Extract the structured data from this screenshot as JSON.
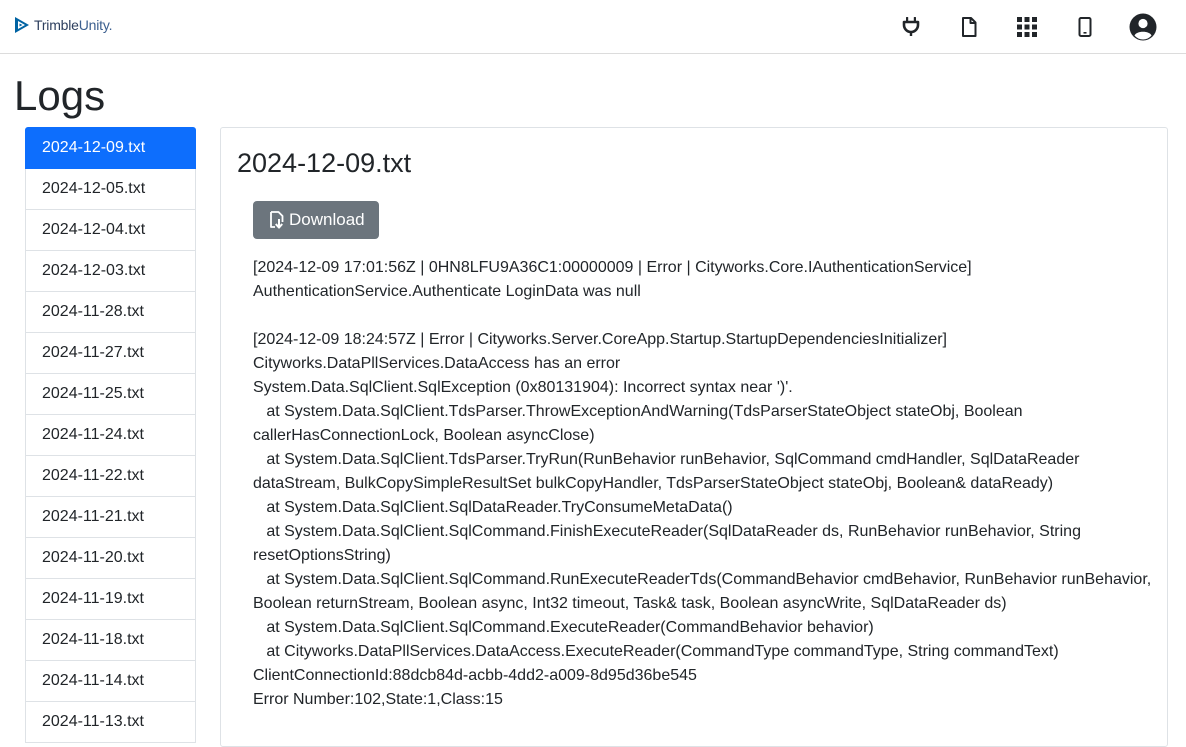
{
  "header": {
    "brand": {
      "name_bold": "Trimble",
      "name_light": "Unity.",
      "icon": "trimble-logo-icon"
    },
    "icons": [
      "plug-icon",
      "document-icon",
      "apps-grid-icon",
      "mobile-device-icon",
      "user-account-icon"
    ],
    "accent_color": "#0d6efd"
  },
  "page": {
    "title": "Logs"
  },
  "files": [
    "2024-12-09.txt",
    "2024-12-05.txt",
    "2024-12-04.txt",
    "2024-12-03.txt",
    "2024-11-28.txt",
    "2024-11-27.txt",
    "2024-11-25.txt",
    "2024-11-24.txt",
    "2024-11-22.txt",
    "2024-11-21.txt",
    "2024-11-20.txt",
    "2024-11-19.txt",
    "2024-11-18.txt",
    "2024-11-14.txt",
    "2024-11-13.txt"
  ],
  "selected_file_index": 0,
  "log": {
    "title": "2024-12-09.txt",
    "download_label": "Download",
    "download_icon": "file-download-icon",
    "content": "[2024-12-09 17:01:56Z | 0HN8LFU9A36C1:00000009 | Error | Cityworks.Core.IAuthenticationService]\nAuthenticationService.Authenticate LoginData was null\n\n[2024-12-09 18:24:57Z | Error | Cityworks.Server.CoreApp.Startup.StartupDependenciesInitializer]\nCityworks.DataPllServices.DataAccess has an error\nSystem.Data.SqlClient.SqlException (0x80131904): Incorrect syntax near ')'.\n   at System.Data.SqlClient.TdsParser.ThrowExceptionAndWarning(TdsParserStateObject stateObj, Boolean callerHasConnectionLock, Boolean asyncClose)\n   at System.Data.SqlClient.TdsParser.TryRun(RunBehavior runBehavior, SqlCommand cmdHandler, SqlDataReader dataStream, BulkCopySimpleResultSet bulkCopyHandler, TdsParserStateObject stateObj, Boolean& dataReady)\n   at System.Data.SqlClient.SqlDataReader.TryConsumeMetaData()\n   at System.Data.SqlClient.SqlCommand.FinishExecuteReader(SqlDataReader ds, RunBehavior runBehavior, String resetOptionsString)\n   at System.Data.SqlClient.SqlCommand.RunExecuteReaderTds(CommandBehavior cmdBehavior, RunBehavior runBehavior, Boolean returnStream, Boolean async, Int32 timeout, Task& task, Boolean asyncWrite, SqlDataReader ds)\n   at System.Data.SqlClient.SqlCommand.ExecuteReader(CommandBehavior behavior)\n   at Cityworks.DataPllServices.DataAccess.ExecuteReader(CommandType commandType, String commandText)\nClientConnectionId:88dcb84d-acbb-4dd2-a009-8d95d36be545\nError Number:102,State:1,Class:15"
  }
}
